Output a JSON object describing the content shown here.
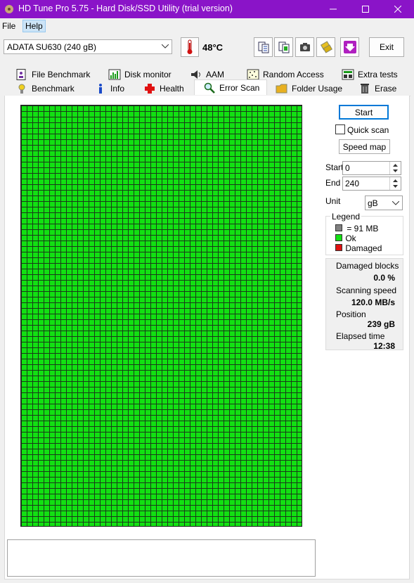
{
  "window": {
    "title": "HD Tune Pro 5.75 - Hard Disk/SSD Utility (trial version)",
    "minimize_icon": "minimize-icon",
    "maximize_icon": "maximize-icon",
    "close_icon": "close-icon"
  },
  "menu": {
    "items": [
      {
        "label": "File"
      },
      {
        "label": "Help"
      }
    ]
  },
  "toolbar": {
    "drive_selected": "ADATA SU630 (240 gB)",
    "temperature": "48°C",
    "exit_label": "Exit",
    "icons": [
      "copy-text-icon",
      "copy-info-icon",
      "screenshot-icon",
      "options-icon",
      "save-down-icon"
    ]
  },
  "tabs": {
    "row1": [
      {
        "label": "File Benchmark",
        "icon": "file-benchmark-icon"
      },
      {
        "label": "Disk monitor",
        "icon": "disk-monitor-icon"
      },
      {
        "label": "AAM",
        "icon": "speaker-icon"
      },
      {
        "label": "Random Access",
        "icon": "random-access-icon"
      },
      {
        "label": "Extra tests",
        "icon": "extra-tests-icon"
      }
    ],
    "row2": [
      {
        "label": "Benchmark",
        "icon": "benchmark-icon"
      },
      {
        "label": "Info",
        "icon": "info-icon"
      },
      {
        "label": "Health",
        "icon": "health-cross-icon"
      },
      {
        "label": "Error Scan",
        "icon": "magnifier-icon",
        "active": true
      },
      {
        "label": "Folder Usage",
        "icon": "folder-icon"
      },
      {
        "label": "Erase",
        "icon": "trash-icon"
      }
    ]
  },
  "error_scan": {
    "start_button": "Start",
    "quick_scan_label": "Quick scan",
    "quick_scan_checked": false,
    "speed_map_button": "Speed map",
    "start_label": "Start",
    "start_value": "0",
    "end_label": "End",
    "end_value": "240",
    "unit_label": "Unit",
    "unit_value": "gB",
    "legend": {
      "title": "Legend",
      "block_size": "= 91 MB",
      "ok": "Ok",
      "damaged": "Damaged",
      "colors": {
        "block": "#808080",
        "ok": "#12e012",
        "damaged": "#e01010"
      }
    },
    "stats": {
      "damaged_blocks_label": "Damaged blocks",
      "damaged_blocks_value": "0.0 %",
      "scanning_speed_label": "Scanning speed",
      "scanning_speed_value": "120.0 MB/s",
      "position_label": "Position",
      "position_value": "239 gB",
      "elapsed_label": "Elapsed time",
      "elapsed_value": "12:38"
    },
    "grid_color": "#12e012",
    "log_text": ""
  }
}
